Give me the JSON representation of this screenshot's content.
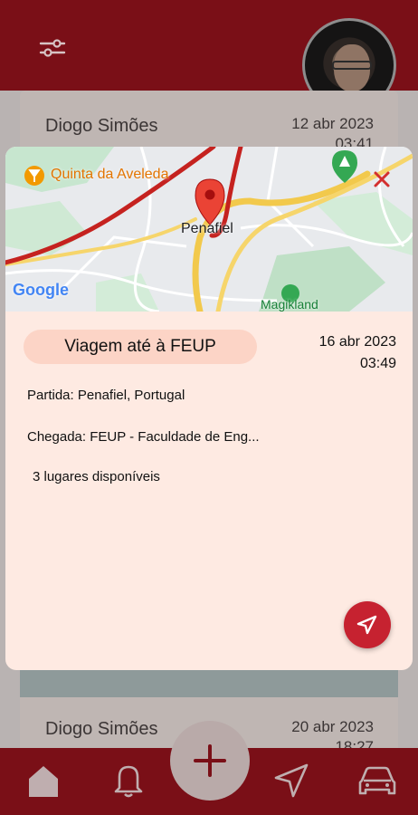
{
  "background": {
    "cards": [
      {
        "driver": "Diogo Simões",
        "date": "12 abr 2023",
        "time": "03:41"
      },
      {
        "driver": "Diogo Simões",
        "date": "20 abr 2023",
        "time": "18:27"
      }
    ]
  },
  "map": {
    "places": {
      "quinta": "Quinta da Aveleda",
      "city": "Penafiel",
      "park": "Magikland"
    },
    "attribution": "Google"
  },
  "trip": {
    "title": "Viagem até à FEUP",
    "date": "16 abr 2023",
    "time": "03:49",
    "departure_label": "Partida:",
    "departure_value": "Penafiel, Portugal",
    "arrival_label": "Chegada:",
    "arrival_value": "FEUP - Faculdade de Eng...",
    "seats": "3 lugares disponíveis"
  },
  "nav": {
    "items": [
      "home-icon",
      "bell-icon",
      "add-icon",
      "navigation-icon",
      "car-icon"
    ]
  },
  "colors": {
    "brand": "#7a0f17",
    "accent": "#c62230",
    "modal_bg": "#feeae2",
    "pill_bg": "#fcd4c6"
  }
}
